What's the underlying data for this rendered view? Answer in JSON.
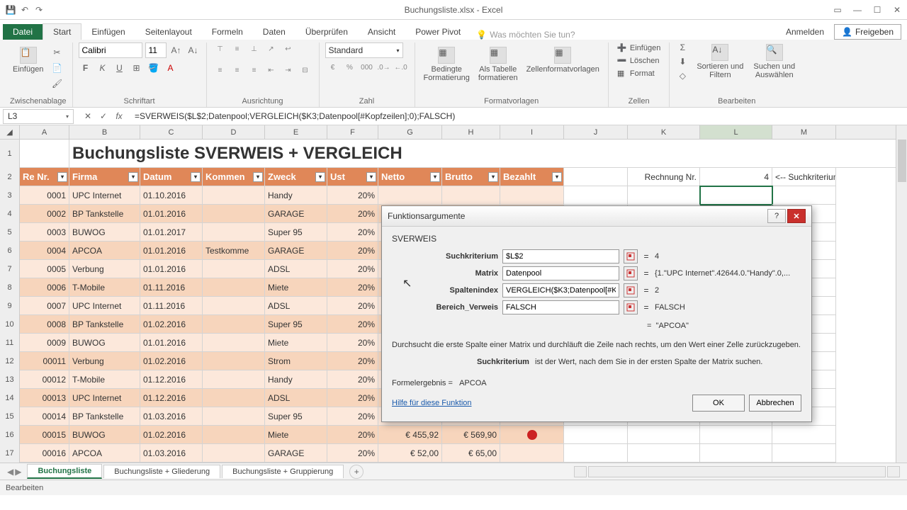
{
  "title": "Buchungsliste.xlsx - Excel",
  "tabs": {
    "file": "Datei",
    "start": "Start",
    "insert": "Einfügen",
    "layout": "Seitenlayout",
    "formulas": "Formeln",
    "data": "Daten",
    "review": "Überprüfen",
    "view": "Ansicht",
    "powerpivot": "Power Pivot",
    "tell": "Was möchten Sie tun?"
  },
  "account": {
    "signin": "Anmelden",
    "share": "Freigeben"
  },
  "ribbon": {
    "clipboard": {
      "paste": "Einfügen",
      "label": "Zwischenablage"
    },
    "font": {
      "name": "Calibri",
      "size": "11",
      "label": "Schriftart"
    },
    "align": {
      "label": "Ausrichtung"
    },
    "number": {
      "format": "Standard",
      "label": "Zahl"
    },
    "styles": {
      "cond": "Bedingte\nFormatierung",
      "table": "Als Tabelle\nformatieren",
      "cell": "Zellenformatvorlagen",
      "label": "Formatvorlagen"
    },
    "cells": {
      "insert": "Einfügen",
      "delete": "Löschen",
      "format": "Format",
      "label": "Zellen"
    },
    "edit": {
      "sort": "Sortieren und\nFiltern",
      "find": "Suchen und\nAuswählen",
      "label": "Bearbeiten"
    }
  },
  "namebox": "L3",
  "formula": "=SVERWEIS($L$2;Datenpool;VERGLEICH($K3;Datenpool[#Kopfzeilen];0);FALSCH)",
  "cols": [
    "A",
    "B",
    "C",
    "D",
    "E",
    "F",
    "G",
    "H",
    "I",
    "J",
    "K",
    "L",
    "M"
  ],
  "sheet": {
    "title": "Buchungsliste SVERWEIS + VERGLEICH",
    "headers": [
      "Re Nr.",
      "Firma",
      "Datum",
      "Kommen",
      "Zweck",
      "Ust",
      "Netto",
      "Brutto",
      "Bezahlt"
    ],
    "k2": "Rechnung Nr.",
    "l2": "4",
    "m2": "<-- Suchkriterium",
    "rows": [
      {
        "r": "3",
        "a": "0001",
        "b": "UPC Internet",
        "c": "01.10.2016",
        "d": "",
        "e": "Handy",
        "f": "20%"
      },
      {
        "r": "4",
        "a": "0002",
        "b": "BP Tankstelle",
        "c": "01.01.2016",
        "d": "",
        "e": "GARAGE",
        "f": "20%"
      },
      {
        "r": "5",
        "a": "0003",
        "b": "BUWOG",
        "c": "01.01.2017",
        "d": "",
        "e": "Super 95",
        "f": "20%"
      },
      {
        "r": "6",
        "a": "0004",
        "b": "APCOA",
        "c": "01.01.2016",
        "d": "Testkomme",
        "e": "GARAGE",
        "f": "20%"
      },
      {
        "r": "7",
        "a": "0005",
        "b": "Verbung",
        "c": "01.01.2016",
        "d": "",
        "e": "ADSL",
        "f": "20%"
      },
      {
        "r": "8",
        "a": "0006",
        "b": "T-Mobile",
        "c": "01.11.2016",
        "d": "",
        "e": "Miete",
        "f": "20%"
      },
      {
        "r": "9",
        "a": "0007",
        "b": "UPC Internet",
        "c": "01.11.2016",
        "d": "",
        "e": "ADSL",
        "f": "20%"
      },
      {
        "r": "10",
        "a": "0008",
        "b": "BP Tankstelle",
        "c": "01.02.2016",
        "d": "",
        "e": "Super 95",
        "f": "20%"
      },
      {
        "r": "11",
        "a": "0009",
        "b": "BUWOG",
        "c": "01.01.2016",
        "d": "",
        "e": "Miete",
        "f": "20%"
      },
      {
        "r": "12",
        "a": "00011",
        "b": "Verbung",
        "c": "01.02.2016",
        "d": "",
        "e": "Strom",
        "f": "20%"
      },
      {
        "r": "13",
        "a": "00012",
        "b": "T-Mobile",
        "c": "01.12.2016",
        "d": "",
        "e": "Handy",
        "f": "20%"
      },
      {
        "r": "14",
        "a": "00013",
        "b": "UPC Internet",
        "c": "01.12.2016",
        "d": "",
        "e": "ADSL",
        "f": "20%"
      },
      {
        "r": "15",
        "a": "00014",
        "b": "BP Tankstelle",
        "c": "01.03.2016",
        "d": "",
        "e": "Super 95",
        "f": "20%"
      },
      {
        "r": "16",
        "a": "00015",
        "b": "BUWOG",
        "c": "01.02.2016",
        "d": "",
        "e": "Miete",
        "f": "20%",
        "g": "€     455,92",
        "h": "€  569,90",
        "dot": true
      },
      {
        "r": "17",
        "a": "00016",
        "b": "APCOA",
        "c": "01.03.2016",
        "d": "",
        "e": "GARAGE",
        "f": "20%",
        "g": "€       52,00",
        "h": "€    65,00"
      }
    ]
  },
  "dialog": {
    "title": "Funktionsargumente",
    "fn": "SVERWEIS",
    "args": [
      {
        "label": "Suchkriterium",
        "val": "$L$2",
        "res": "4"
      },
      {
        "label": "Matrix",
        "val": "Datenpool",
        "res": "{1.\"UPC Internet\".42644.0.\"Handy\".0,..."
      },
      {
        "label": "Spaltenindex",
        "val": "VERGLEICH($K3;Datenpool[#Ko",
        "res": "2"
      },
      {
        "label": "Bereich_Verweis",
        "val": "FALSCH",
        "res": "FALSCH"
      }
    ],
    "evalres": "\"APCOA\"",
    "desc": "Durchsucht die erste Spalte einer Matrix und durchläuft die Zeile nach rechts, um den Wert einer Zelle zurückzugeben.",
    "hint_label": "Suchkriterium",
    "hint_text": "ist der Wert, nach dem Sie in der ersten Spalte der Matrix suchen.",
    "result_label": "Formelergebnis =",
    "result_val": "APCOA",
    "help": "Hilfe für diese Funktion",
    "ok": "OK",
    "cancel": "Abbrechen"
  },
  "sheettabs": [
    "Buchungsliste",
    "Buchungsliste + Gliederung",
    "Buchungsliste + Gruppierung"
  ],
  "status": "Bearbeiten"
}
